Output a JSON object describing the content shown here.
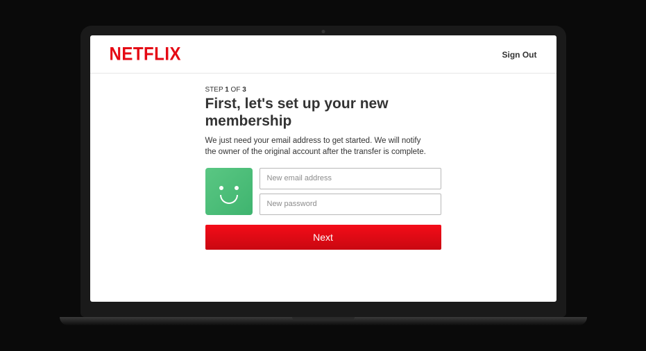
{
  "brand": "NETFLIX",
  "header": {
    "signout": "Sign Out"
  },
  "step": {
    "prefix": "STEP ",
    "current": "1",
    "mid": " OF ",
    "total": "3"
  },
  "title": "First, let's set up your new membership",
  "description": "We just need your email address to get started. We will notify the owner of the original account after the transfer is complete.",
  "form": {
    "email_placeholder": "New email address",
    "password_placeholder": "New password",
    "next": "Next"
  }
}
